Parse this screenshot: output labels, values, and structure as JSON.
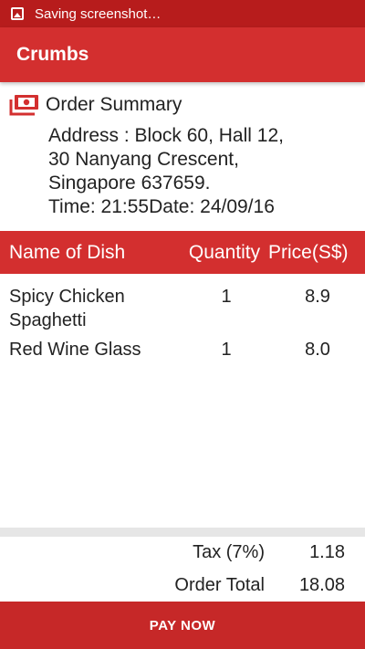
{
  "status_bar": {
    "text": "Saving screenshot…"
  },
  "app_bar": {
    "title": "Crumbs"
  },
  "summary": {
    "title": "Order Summary",
    "address_line1": "Address : Block 60, Hall 12,",
    "address_line2": "30 Nanyang Crescent,",
    "address_line3": "Singapore 637659.",
    "time_date": "Time: 21:55Date: 24/09/16"
  },
  "table": {
    "headers": {
      "name": "Name of Dish",
      "quantity": "Quantity",
      "price": "Price(S$)"
    },
    "rows": [
      {
        "name": "Spicy Chicken Spaghetti",
        "quantity": "1",
        "price": "8.9"
      },
      {
        "name": "Red Wine Glass",
        "quantity": "1",
        "price": "8.0"
      }
    ]
  },
  "totals": {
    "tax_label": "Tax (7%)",
    "tax_value": "1.18",
    "total_label": "Order Total",
    "total_value": "18.08"
  },
  "pay_button": {
    "label": "PAY NOW"
  },
  "colors": {
    "primary": "#d32f2f",
    "status_bar": "#b71c1c",
    "button": "#c62828",
    "divider": "#e6e6e6"
  },
  "icons": {
    "status": "image-icon",
    "summary": "money-icon"
  }
}
